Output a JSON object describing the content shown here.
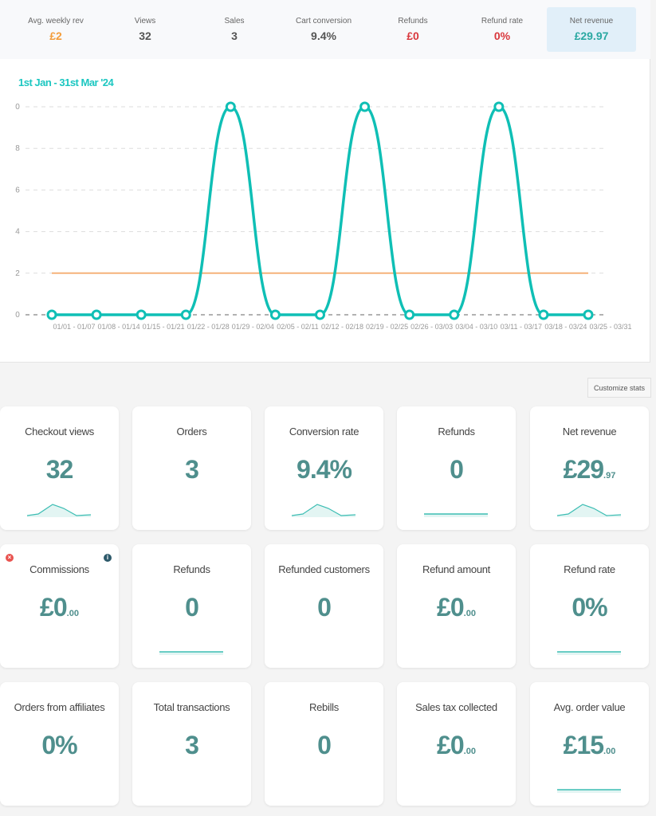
{
  "summary": [
    {
      "label": "Avg. weekly rev",
      "value": "£2",
      "color": "#f39c3a"
    },
    {
      "label": "Views",
      "value": "32",
      "color": "#555555"
    },
    {
      "label": "Sales",
      "value": "3",
      "color": "#555555"
    },
    {
      "label": "Cart conversion",
      "value": "9.4%",
      "color": "#555555"
    },
    {
      "label": "Refunds",
      "value": "£0",
      "color": "#d9373c"
    },
    {
      "label": "Refund rate",
      "value": "0%",
      "color": "#d9373c"
    },
    {
      "label": "Net revenue",
      "value": "£29.97",
      "color": "#2aa8a2",
      "highlight": true
    }
  ],
  "chart_data": {
    "type": "line",
    "title": "1st Jan - 31st Mar '24",
    "categories": [
      "01/01 - 01/07",
      "01/08 - 01/14",
      "01/15 - 01/21",
      "01/22 - 01/28",
      "01/29 - 02/04",
      "02/05 - 02/11",
      "02/12 - 02/18",
      "02/19 - 02/25",
      "02/26 - 03/03",
      "03/04 - 03/10",
      "03/11 - 03/17",
      "03/18 - 03/24",
      "03/25 - 03/31"
    ],
    "yticks": [
      "0",
      "2",
      "4",
      "6",
      "8",
      "0"
    ],
    "ylim": [
      0,
      10
    ],
    "grid": true,
    "series": [
      {
        "values": [
          0,
          0,
          0,
          0,
          10,
          0,
          0,
          10,
          0,
          0,
          10,
          0,
          0
        ],
        "color": "#0fbfb5",
        "smooth": true
      },
      {
        "values": [
          2,
          2,
          2,
          2,
          2,
          2,
          2,
          2,
          2,
          2,
          2,
          2,
          2
        ],
        "color": "#f5b27a"
      }
    ]
  },
  "customize_label": "Customize stats",
  "cards": [
    {
      "title": "Checkout views",
      "main": "32",
      "cents": "",
      "spark": "peak"
    },
    {
      "title": "Orders",
      "main": "3",
      "cents": "",
      "spark": ""
    },
    {
      "title": "Conversion rate",
      "main": "9.4%",
      "cents": "",
      "spark": "peak"
    },
    {
      "title": "Refunds",
      "main": "0",
      "cents": "",
      "spark": "flat"
    },
    {
      "title": "Net revenue",
      "main": "£29",
      "cents": ".97",
      "spark": "peak"
    },
    {
      "title": "Commissions",
      "main": "£0",
      "cents": ".00",
      "spark": "",
      "icons": true
    },
    {
      "title": "Refunds",
      "main": "0",
      "cents": "",
      "spark": "flat"
    },
    {
      "title": "Refunded customers",
      "main": "0",
      "cents": "",
      "spark": ""
    },
    {
      "title": "Refund amount",
      "main": "£0",
      "cents": ".00",
      "spark": ""
    },
    {
      "title": "Refund rate",
      "main": "0%",
      "cents": "",
      "spark": "flat"
    },
    {
      "title": "Orders from affiliates",
      "main": "0%",
      "cents": "",
      "spark": ""
    },
    {
      "title": "Total transactions",
      "main": "3",
      "cents": "",
      "spark": ""
    },
    {
      "title": "Rebills",
      "main": "0",
      "cents": "",
      "spark": ""
    },
    {
      "title": "Sales tax collected",
      "main": "£0",
      "cents": ".00",
      "spark": ""
    },
    {
      "title": "Avg. order value",
      "main": "£15",
      "cents": ".00",
      "spark": "flat"
    }
  ]
}
